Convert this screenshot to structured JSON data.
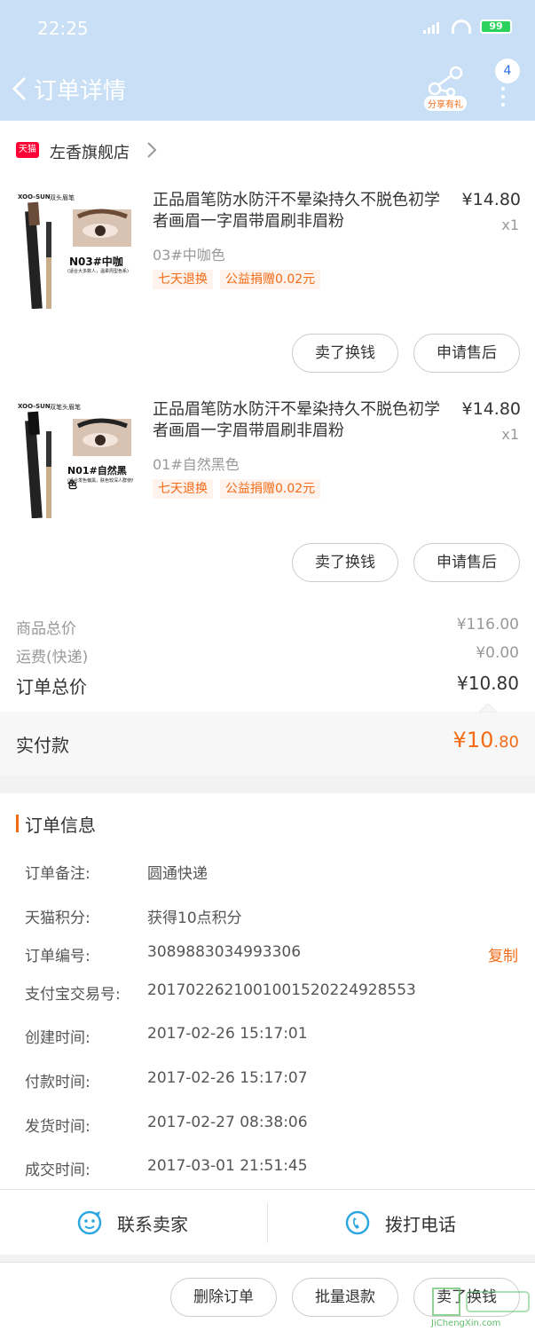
{
  "status_bar": {
    "time": "22:25",
    "battery": "99"
  },
  "nav": {
    "title": "订单详情",
    "share_label": "分享有礼",
    "more_badge": "4"
  },
  "store": {
    "badge": "天猫",
    "name": "左香旗舰店"
  },
  "items": [
    {
      "thumb_brand": "XOO-SUN",
      "thumb_type": "双头眉笔",
      "thumb_code": "N03#中咖",
      "thumb_note": "(适合大多数人，温柔周型色系)",
      "title": "正品眉笔防水防汗不晕染持久不脱色初学者画眉一字眉带眉刷非眉粉",
      "price": "¥14.80",
      "qty": "x1",
      "sku": "03#中咖色",
      "tags": [
        "七天退换",
        "公益捐赠0.02元"
      ],
      "buttons": [
        "卖了换钱",
        "申请售后"
      ]
    },
    {
      "thumb_brand": "XOO-SUN",
      "thumb_type": "双笔头眉笔",
      "thumb_code": "N01#自然黑色",
      "thumb_note": "(适合发色偏黑，肤色较深人群使用)",
      "title": "正品眉笔防水防汗不晕染持久不脱色初学者画眉一字眉带眉刷非眉粉",
      "price": "¥14.80",
      "qty": "x1",
      "sku": "01#自然黑色",
      "tags": [
        "七天退换",
        "公益捐赠0.02元"
      ],
      "buttons": [
        "卖了换钱",
        "申请售后"
      ]
    }
  ],
  "summary": {
    "goods_label": "商品总价",
    "goods_value": "¥116.00",
    "shipping_label": "运费(快递)",
    "shipping_value": "¥0.00",
    "total_label": "订单总价",
    "total_value": "¥10.80"
  },
  "paid": {
    "label": "实付款",
    "currency_int": "¥10",
    "decimal": ".80"
  },
  "order_info": {
    "title": "订单信息",
    "rows": [
      {
        "label": "订单备注:",
        "value": "圆通快递"
      },
      {
        "label": "天猫积分:",
        "value": "获得10点积分"
      },
      {
        "label": "订单编号:",
        "value": "3089883034993306",
        "action": "复制"
      },
      {
        "label": "支付宝交易号:",
        "value": "2017022621001001520224928553"
      },
      {
        "label": "创建时间:",
        "value": "2017-02-26 15:17:01"
      },
      {
        "label": "付款时间:",
        "value": "2017-02-26 15:17:07"
      },
      {
        "label": "发货时间:",
        "value": "2017-02-27 08:38:06"
      },
      {
        "label": "成交时间:",
        "value": "2017-03-01 21:51:45"
      }
    ]
  },
  "contact": {
    "seller": "联系卖家",
    "phone": "拨打电话"
  },
  "bottom_buttons": [
    "删除订单",
    "批量退款",
    "卖了换钱"
  ],
  "watermark": {
    "text": "JiChengXin.com"
  }
}
